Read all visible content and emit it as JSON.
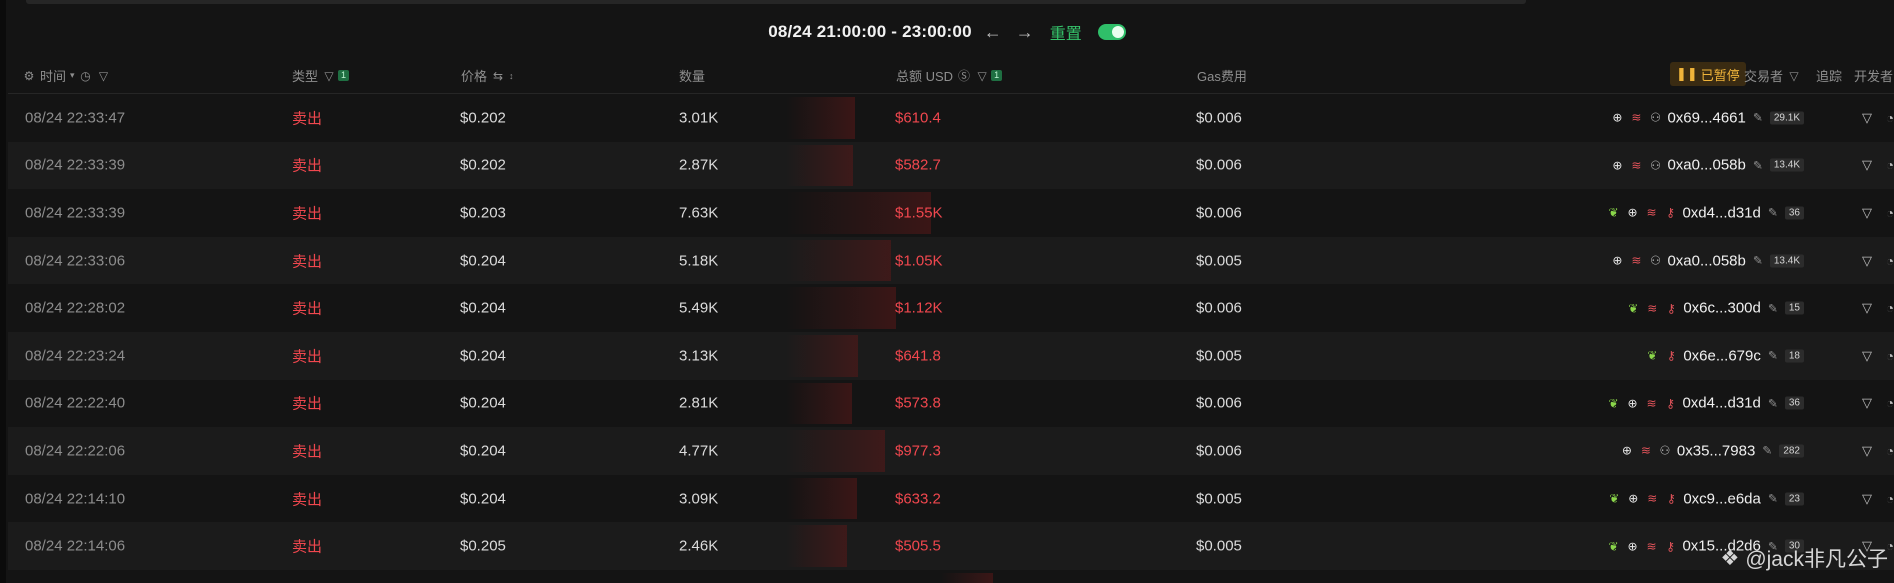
{
  "range": {
    "text": "08/24 21:00:00 - 23:00:00",
    "reset_label": "重置",
    "toggle_on": true
  },
  "header": {
    "time": "时间",
    "type": "类型",
    "type_badge": "1",
    "price": "价格",
    "qty": "数量",
    "total": "总额 USD",
    "total_badge": "1",
    "gas": "Gas费用",
    "paused": "已暂停",
    "trader": "交易者",
    "tracking": "追踪",
    "developer": "开发者"
  },
  "colors": {
    "sell": "#f0474e",
    "accent_green": "#35c26a",
    "paused": "#f0b43a"
  },
  "rows": [
    {
      "time": "08/24 22:33:47",
      "type": "卖出",
      "price": "$0.202",
      "qty": "3.01K",
      "total": "$610.4",
      "total_value": 610.4,
      "gas": "$0.006",
      "addr": "0x69...4661",
      "count": "29.1K",
      "icons": [
        "target",
        "layers",
        "bot"
      ]
    },
    {
      "time": "08/24 22:33:39",
      "type": "卖出",
      "price": "$0.202",
      "qty": "2.87K",
      "total": "$582.7",
      "total_value": 582.7,
      "gas": "$0.006",
      "addr": "0xa0...058b",
      "count": "13.4K",
      "icons": [
        "target",
        "layers",
        "bot"
      ]
    },
    {
      "time": "08/24 22:33:39",
      "type": "卖出",
      "price": "$0.203",
      "qty": "7.63K",
      "total": "$1.55K",
      "total_value": 1550,
      "gas": "$0.006",
      "addr": "0xd4...d31d",
      "count": "36",
      "icons": [
        "leaf",
        "target",
        "layers",
        "key"
      ]
    },
    {
      "time": "08/24 22:33:06",
      "type": "卖出",
      "price": "$0.204",
      "qty": "5.18K",
      "total": "$1.05K",
      "total_value": 1050,
      "gas": "$0.005",
      "addr": "0xa0...058b",
      "count": "13.4K",
      "icons": [
        "target",
        "layers",
        "bot"
      ]
    },
    {
      "time": "08/24 22:28:02",
      "type": "卖出",
      "price": "$0.204",
      "qty": "5.49K",
      "total": "$1.12K",
      "total_value": 1120,
      "gas": "$0.006",
      "addr": "0x6c...300d",
      "count": "15",
      "icons": [
        "leaf",
        "layers",
        "key"
      ]
    },
    {
      "time": "08/24 22:23:24",
      "type": "卖出",
      "price": "$0.204",
      "qty": "3.13K",
      "total": "$641.8",
      "total_value": 641.8,
      "gas": "$0.005",
      "addr": "0x6e...679c",
      "count": "18",
      "icons": [
        "leaf",
        "key"
      ]
    },
    {
      "time": "08/24 22:22:40",
      "type": "卖出",
      "price": "$0.204",
      "qty": "2.81K",
      "total": "$573.8",
      "total_value": 573.8,
      "gas": "$0.006",
      "addr": "0xd4...d31d",
      "count": "36",
      "icons": [
        "leaf",
        "target",
        "layers",
        "key"
      ]
    },
    {
      "time": "08/24 22:22:06",
      "type": "卖出",
      "price": "$0.204",
      "qty": "4.77K",
      "total": "$977.3",
      "total_value": 977.3,
      "gas": "$0.006",
      "addr": "0x35...7983",
      "count": "282",
      "icons": [
        "target",
        "layers",
        "bot"
      ]
    },
    {
      "time": "08/24 22:14:10",
      "type": "卖出",
      "price": "$0.204",
      "qty": "3.09K",
      "total": "$633.2",
      "total_value": 633.2,
      "gas": "$0.005",
      "addr": "0xc9...e6da",
      "count": "23",
      "icons": [
        "leaf",
        "target",
        "layers",
        "key"
      ]
    },
    {
      "time": "08/24 22:14:06",
      "type": "卖出",
      "price": "$0.205",
      "qty": "2.46K",
      "total": "$505.5",
      "total_value": 505.5,
      "gas": "$0.005",
      "addr": "0x15...d2d6",
      "count": "30",
      "icons": [
        "leaf",
        "target",
        "layers",
        "key"
      ]
    }
  ],
  "watermark": "@jack非凡公子"
}
